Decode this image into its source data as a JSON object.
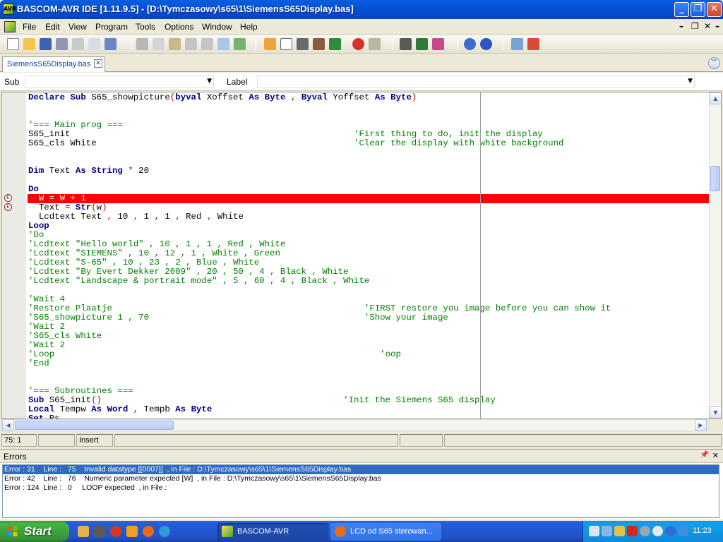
{
  "window": {
    "title": "BASCOM-AVR IDE [1.11.9.5] - [D:\\Tymczasowy\\s65\\1\\SiemensS65Display.bas]",
    "app_icon": "bascom-app-icon"
  },
  "menubar": {
    "items": [
      "File",
      "Edit",
      "View",
      "Program",
      "Tools",
      "Options",
      "Window",
      "Help"
    ]
  },
  "document_tab": {
    "label": "SiemensS65Display.bas"
  },
  "subbar": {
    "sub_label": "Sub",
    "sub_value": "",
    "label_label": "Label",
    "label_value": ""
  },
  "editor": {
    "highlight_color": "#ff0000",
    "error_markers": [
      "error-marker-icon",
      "error-marker-icon"
    ],
    "lines": [
      [
        [
          "kw",
          "Declare"
        ],
        [
          "t",
          " "
        ],
        [
          "kw",
          "Sub"
        ],
        [
          "t",
          " S65_showpicture"
        ],
        [
          "op",
          "("
        ],
        [
          "kw",
          "byval"
        ],
        [
          "t",
          " Xoffset "
        ],
        [
          "kw",
          "As"
        ],
        [
          "t",
          " "
        ],
        [
          "kw",
          "Byte"
        ],
        [
          "t",
          " "
        ],
        [
          "op",
          ","
        ],
        [
          "t",
          " "
        ],
        [
          "kw",
          "Byval"
        ],
        [
          "t",
          " Yoffset "
        ],
        [
          "kw",
          "As"
        ],
        [
          "t",
          " "
        ],
        [
          "kw",
          "Byte"
        ],
        [
          "op",
          ")"
        ]
      ],
      [],
      [],
      [
        [
          "cm",
          "'=== Main prog ==="
        ]
      ],
      [
        [
          "t",
          "S65_init                                                      "
        ],
        [
          "cm",
          "'First thing to do, init the display"
        ]
      ],
      [
        [
          "t",
          "S65_cls White                                                 "
        ],
        [
          "cm",
          "'Clear the display with white background"
        ]
      ],
      [],
      [],
      [
        [
          "kw",
          "Dim"
        ],
        [
          "t",
          " Text "
        ],
        [
          "kw",
          "As"
        ],
        [
          "t",
          " "
        ],
        [
          "kw",
          "String"
        ],
        [
          "t",
          " "
        ],
        [
          "op",
          "*"
        ],
        [
          "t",
          " 20"
        ]
      ],
      [],
      [
        [
          "kw",
          "Do"
        ]
      ],
      [
        [
          "hl",
          "  W = W + 1"
        ]
      ],
      [
        [
          "t",
          "  Text = "
        ],
        [
          "kw",
          "Str"
        ],
        [
          "op",
          "("
        ],
        [
          "t",
          "w"
        ],
        [
          "op",
          ")"
        ]
      ],
      [
        [
          "t",
          "  Lcdtext Text "
        ],
        [
          "op",
          ","
        ],
        [
          "t",
          " 10 "
        ],
        [
          "op",
          ","
        ],
        [
          "t",
          " 1 "
        ],
        [
          "op",
          ","
        ],
        [
          "t",
          " 1 "
        ],
        [
          "op",
          ","
        ],
        [
          "t",
          " Red "
        ],
        [
          "op",
          ","
        ],
        [
          "t",
          " White"
        ]
      ],
      [
        [
          "kw",
          "Loop"
        ]
      ],
      [
        [
          "cm",
          "'Do"
        ]
      ],
      [
        [
          "cm",
          "'Lcdtext \"Hello world\" , 10 , 1 , 1 , Red , White"
        ]
      ],
      [
        [
          "cm",
          "'Lcdtext \"SIEMENS\" , 10 , 12 , 1 , White , Green"
        ]
      ],
      [
        [
          "cm",
          "'Lcdtext \"S-65\" , 10 , 23 , 2 , Blue , White"
        ]
      ],
      [
        [
          "cm",
          "'Lcdtext \"By Evert Dekker 2009\" , 20 , 50 , 4 , Black , White"
        ]
      ],
      [
        [
          "cm",
          "'Lcdtext \"Landscape & portrait mode\" , 5 , 60 , 4 , Black , White"
        ]
      ],
      [],
      [
        [
          "cm",
          "'Wait 4"
        ]
      ],
      [
        [
          "cm",
          "'Restore Plaatje                                                'FIRST restore you image before you can show it"
        ]
      ],
      [
        [
          "cm",
          "'S65_showpicture 1 , 70                                         'Show your image"
        ]
      ],
      [
        [
          "cm",
          "'Wait 2"
        ]
      ],
      [
        [
          "cm",
          "'S65_cls White"
        ]
      ],
      [
        [
          "cm",
          "'Wait 2"
        ]
      ],
      [
        [
          "cm",
          "'Loop                                                              'oop"
        ]
      ],
      [
        [
          "cm",
          "'End"
        ]
      ],
      [],
      [],
      [
        [
          "cm",
          "'=== Subroutines ==="
        ]
      ],
      [
        [
          "kw",
          "Sub"
        ],
        [
          "t",
          " S65_init"
        ],
        [
          "op",
          "()"
        ],
        [
          "t",
          "                                              "
        ],
        [
          "cm",
          "'Init the Siemens S65 display"
        ]
      ],
      [
        [
          "kw",
          "Local"
        ],
        [
          "t",
          " Tempw "
        ],
        [
          "kw",
          "As"
        ],
        [
          "t",
          " "
        ],
        [
          "kw",
          "Word"
        ],
        [
          "t",
          " "
        ],
        [
          "op",
          ","
        ],
        [
          "t",
          " Tempb "
        ],
        [
          "kw",
          "As"
        ],
        [
          "t",
          " "
        ],
        [
          "kw",
          "Byte"
        ]
      ],
      [
        [
          "kw",
          "Set"
        ],
        [
          "t",
          " Rs"
        ]
      ]
    ]
  },
  "statusbar": {
    "position": "75: 1",
    "field2": "",
    "mode": "Insert"
  },
  "errors": {
    "title": "Errors",
    "rows": [
      "Error : 31    Line :   75    Invalid datatype [[0007]]  , in File : D:\\Tymczasowy\\s65\\1\\SiemensS65Display.bas",
      "Error : 42    Line :   76    Numeric parameter expected [W]  , in File : D:\\Tymczasowy\\s65\\1\\SiemensS65Display.bas",
      "Error : 124  Line :   0     LOOP expected  , in File :"
    ]
  },
  "taskbar": {
    "start": "Start",
    "tasks": [
      {
        "label": "BASCOM-AVR",
        "icon": "bascom-task-icon"
      },
      {
        "label": "LCD od S65 sterowan...",
        "icon": "firefox-task-icon"
      }
    ],
    "clock": "11:23"
  }
}
